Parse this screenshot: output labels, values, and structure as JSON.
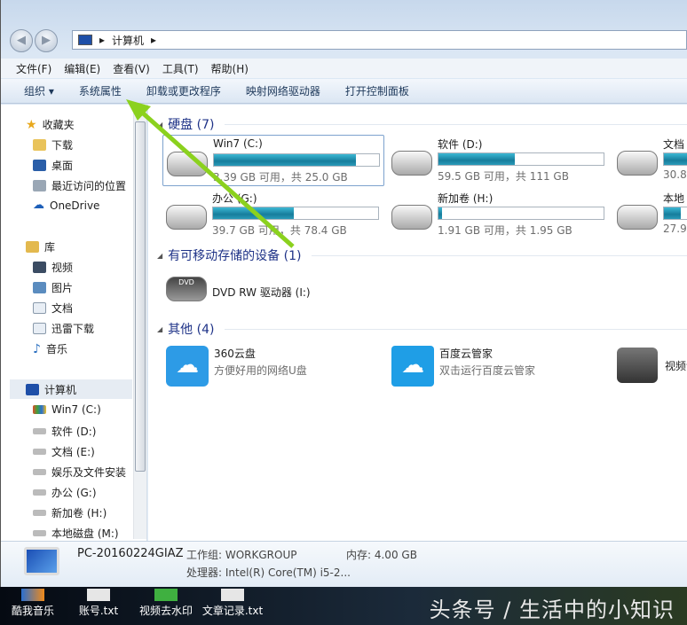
{
  "address": {
    "path": "计算机"
  },
  "menu": [
    "文件(F)",
    "编辑(E)",
    "查看(V)",
    "工具(T)",
    "帮助(H)"
  ],
  "toolbar": [
    "组织 ▾",
    "系统属性",
    "卸载或更改程序",
    "映射网络驱动器",
    "打开控制面板"
  ],
  "sidebar": {
    "favorites": {
      "label": "收藏夹",
      "items": [
        "下载",
        "桌面",
        "最近访问的位置",
        "OneDrive"
      ]
    },
    "libraries": {
      "label": "库",
      "items": [
        "视频",
        "图片",
        "文档",
        "迅雷下载",
        "音乐"
      ]
    },
    "computer": {
      "label": "计算机",
      "items": [
        "Win7 (C:)",
        "软件 (D:)",
        "文档 (E:)",
        "娱乐及文件安装",
        "办公 (G:)",
        "新加卷 (H:)",
        "本地磁盘 (M:)"
      ]
    }
  },
  "groups": {
    "hdd": "硬盘 (7)",
    "removable": "有可移动存储的设备 (1)",
    "other": "其他 (4)"
  },
  "drives": [
    {
      "name": "Win7 (C:)",
      "info": "3.39 GB 可用，共 25.0 GB",
      "used": 0.86
    },
    {
      "name": "软件 (D:)",
      "info": "59.5 GB 可用，共 111 GB",
      "used": 0.46
    },
    {
      "name": "文档",
      "info": "30.8",
      "used": 0.6
    },
    {
      "name": "办公 (G:)",
      "info": "39.7 GB 可用，共 78.4 GB",
      "used": 0.49
    },
    {
      "name": "新加卷 (H:)",
      "info": "1.91 GB 可用，共 1.95 GB",
      "used": 0.02
    },
    {
      "name": "本地",
      "info": "27.9",
      "used": 0.1
    }
  ],
  "dvd": {
    "name": "DVD RW 驱动器 (I:)",
    "badge": "DVD"
  },
  "others": [
    {
      "name": "360云盘",
      "desc": "方便好用的网络U盘"
    },
    {
      "name": "百度云管家",
      "desc": "双击运行百度云管家"
    },
    {
      "name": "视频设"
    }
  ],
  "details": {
    "pc": "PC-20160224GIAZ",
    "workgroup": "工作组: WORKGROUP",
    "memory": "内存: 4.00 GB",
    "cpu": "处理器: Intel(R) Core(TM) i5-2..."
  },
  "desktop": [
    "酷我音乐",
    "账号.txt",
    "视频去水印",
    "文章记录.txt"
  ],
  "watermark": "头条号 / 生活中的小知识"
}
